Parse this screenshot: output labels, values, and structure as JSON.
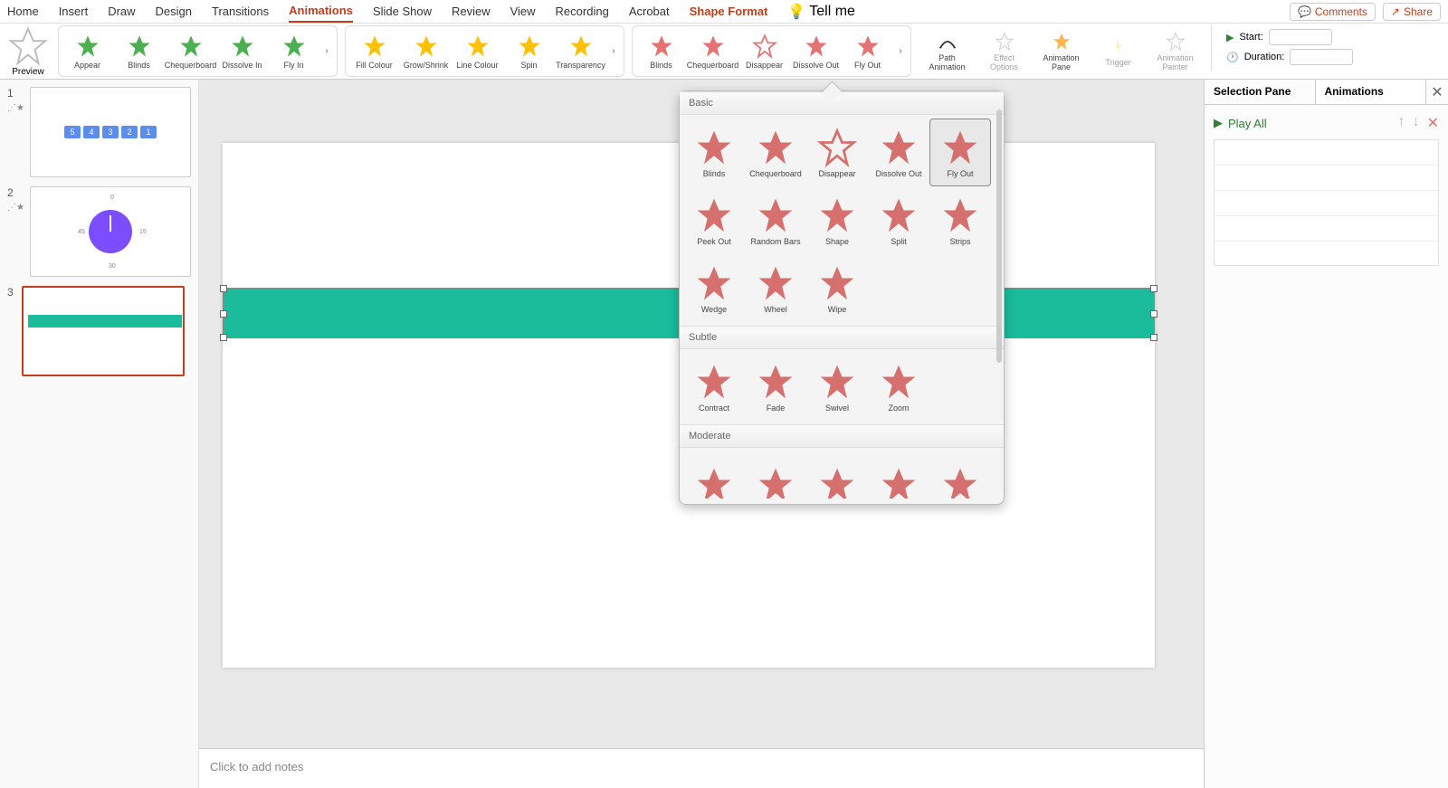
{
  "tabs": {
    "home": "Home",
    "insert": "Insert",
    "draw": "Draw",
    "design": "Design",
    "transitions": "Transitions",
    "animations": "Animations",
    "slideshow": "Slide Show",
    "review": "Review",
    "view": "View",
    "recording": "Recording",
    "acrobat": "Acrobat",
    "shape_format": "Shape Format",
    "tell_me": "Tell me"
  },
  "top_right": {
    "comments": "Comments",
    "share": "Share"
  },
  "ribbon": {
    "preview": "Preview",
    "entrance": [
      {
        "label": "Appear",
        "color": "#4caf50"
      },
      {
        "label": "Blinds",
        "color": "#4caf50"
      },
      {
        "label": "Chequerboard",
        "color": "#4caf50"
      },
      {
        "label": "Dissolve In",
        "color": "#4caf50"
      },
      {
        "label": "Fly In",
        "color": "#4caf50"
      }
    ],
    "emphasis": [
      {
        "label": "Fill Colour",
        "color": "#ffc107"
      },
      {
        "label": "Grow/Shrink",
        "color": "#ffc107"
      },
      {
        "label": "Line Colour",
        "color": "#ffc107"
      },
      {
        "label": "Spin",
        "color": "#ffc107"
      },
      {
        "label": "Transparency",
        "color": "#ffc107"
      }
    ],
    "exit": [
      {
        "label": "Blinds",
        "color": "#e57373"
      },
      {
        "label": "Chequerboard",
        "color": "#e57373"
      },
      {
        "label": "Disappear",
        "color": "#e57373"
      },
      {
        "label": "Dissolve Out",
        "color": "#e57373"
      },
      {
        "label": "Fly Out",
        "color": "#e57373"
      }
    ],
    "path_animation": "Path Animation",
    "effect_options": "Effect Options",
    "animation_pane": "Animation Pane",
    "trigger": "Trigger",
    "animation_painter": "Animation Painter"
  },
  "timing": {
    "start_label": "Start:",
    "duration_label": "Duration:",
    "start_value": "",
    "duration_value": ""
  },
  "thumbs": {
    "nums": [
      "1",
      "2",
      "3"
    ],
    "slide1_boxes": [
      "5",
      "4",
      "3",
      "2",
      "1"
    ],
    "slide2_clock": {
      "top": "0",
      "right": "15",
      "bottom": "30",
      "left": "45"
    }
  },
  "notes_placeholder": "Click to add notes",
  "dropdown": {
    "sections": {
      "basic": "Basic",
      "subtle": "Subtle",
      "moderate": "Moderate"
    },
    "basic": [
      "Blinds",
      "Chequerboard",
      "Disappear",
      "Dissolve Out",
      "Fly Out",
      "Peek Out",
      "Random Bars",
      "Shape",
      "Split",
      "Strips",
      "Wedge",
      "Wheel",
      "Wipe"
    ],
    "subtle": [
      "Contract",
      "Fade",
      "Swivel",
      "Zoom"
    ],
    "moderate": [
      "",
      "",
      "",
      "",
      ""
    ],
    "selected": "Fly Out"
  },
  "right_pane": {
    "tab_selection": "Selection Pane",
    "tab_animations": "Animations",
    "play_all": "Play All"
  }
}
